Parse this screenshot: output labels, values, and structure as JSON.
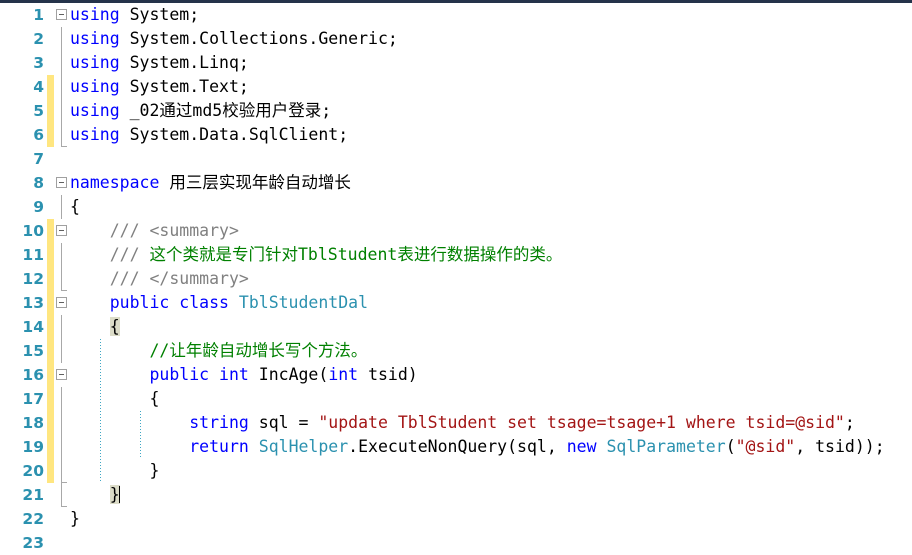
{
  "editor": {
    "language": "csharp",
    "background_color": "#ffffff",
    "top_border_color": "#25334a",
    "colors": {
      "line_number": "#2b91af",
      "keyword": "#0000ff",
      "type": "#2b91af",
      "string": "#a31515",
      "comment": "#008000",
      "doc_comment": "#808080",
      "plain_text": "#000000",
      "change_bar": "#ffe680",
      "brace_highlight": "#dcdcc8",
      "indent_guide": "#3fa7c4",
      "outline_guide": "#a8a8a8"
    },
    "lines": [
      {
        "number": "1",
        "change_bar": false,
        "fold_box": true,
        "fold_guide": "none",
        "indent_guides": [],
        "tokens": [
          {
            "text": "using ",
            "kind": "kw"
          },
          {
            "text": "System;",
            "kind": "plain"
          }
        ]
      },
      {
        "number": "2",
        "change_bar": false,
        "fold_box": false,
        "fold_guide": "full",
        "indent_guides": [],
        "tokens": [
          {
            "text": "using ",
            "kind": "kw"
          },
          {
            "text": "System.Collections.Generic;",
            "kind": "plain"
          }
        ]
      },
      {
        "number": "3",
        "change_bar": false,
        "fold_box": false,
        "fold_guide": "full",
        "indent_guides": [],
        "tokens": [
          {
            "text": "using ",
            "kind": "kw"
          },
          {
            "text": "System.Linq;",
            "kind": "plain"
          }
        ]
      },
      {
        "number": "4",
        "change_bar": true,
        "fold_box": false,
        "fold_guide": "full",
        "indent_guides": [],
        "tokens": [
          {
            "text": "using ",
            "kind": "kw"
          },
          {
            "text": "System.Text;",
            "kind": "plain"
          }
        ]
      },
      {
        "number": "5",
        "change_bar": true,
        "fold_box": false,
        "fold_guide": "full",
        "indent_guides": [],
        "tokens": [
          {
            "text": "using ",
            "kind": "kw"
          },
          {
            "text": "_02通过md5校验用户登录;",
            "kind": "plain"
          }
        ]
      },
      {
        "number": "6",
        "change_bar": true,
        "fold_box": false,
        "fold_guide": "end",
        "indent_guides": [],
        "tokens": [
          {
            "text": "using ",
            "kind": "kw"
          },
          {
            "text": "System.Data.SqlClient;",
            "kind": "plain"
          }
        ]
      },
      {
        "number": "7",
        "change_bar": false,
        "fold_box": false,
        "fold_guide": "none",
        "indent_guides": [],
        "tokens": []
      },
      {
        "number": "8",
        "change_bar": false,
        "fold_box": true,
        "fold_guide": "none",
        "indent_guides": [],
        "tokens": [
          {
            "text": "namespace ",
            "kind": "kw"
          },
          {
            "text": "用三层实现年龄自动增长",
            "kind": "plain"
          }
        ]
      },
      {
        "number": "9",
        "change_bar": false,
        "fold_box": false,
        "fold_guide": "full",
        "indent_guides": [],
        "tokens": [
          {
            "text": "{",
            "kind": "plain"
          }
        ]
      },
      {
        "number": "10",
        "change_bar": true,
        "fold_box": true,
        "fold_guide": "none",
        "indent_guides": [],
        "tokens": [
          {
            "text": "    /// ",
            "kind": "doc"
          },
          {
            "text": "<summary>",
            "kind": "doc"
          }
        ]
      },
      {
        "number": "11",
        "change_bar": true,
        "fold_box": false,
        "fold_guide": "full",
        "indent_guides": [],
        "tokens": [
          {
            "text": "    /// ",
            "kind": "doc"
          },
          {
            "text": "这个类就是专门针对TblStudent表进行数据操作的类。",
            "kind": "cmt"
          }
        ]
      },
      {
        "number": "12",
        "change_bar": true,
        "fold_box": false,
        "fold_guide": "end",
        "indent_guides": [],
        "tokens": [
          {
            "text": "    /// ",
            "kind": "doc"
          },
          {
            "text": "</summary>",
            "kind": "doc"
          }
        ]
      },
      {
        "number": "13",
        "change_bar": true,
        "fold_box": true,
        "fold_guide": "none",
        "indent_guides": [],
        "tokens": [
          {
            "text": "    ",
            "kind": "plain"
          },
          {
            "text": "public class ",
            "kind": "kw"
          },
          {
            "text": "TblStudentDal",
            "kind": "type"
          }
        ]
      },
      {
        "number": "14",
        "change_bar": true,
        "fold_box": false,
        "fold_guide": "full",
        "indent_guides": [],
        "tokens": [
          {
            "text": "    ",
            "kind": "plain"
          },
          {
            "text": "{",
            "kind": "plain",
            "highlight": true
          }
        ]
      },
      {
        "number": "15",
        "change_bar": true,
        "fold_box": false,
        "fold_guide": "full",
        "indent_guides": [
          100
        ],
        "tokens": [
          {
            "text": "        //让年龄自动增长写个方法。",
            "kind": "cmt"
          }
        ]
      },
      {
        "number": "16",
        "change_bar": true,
        "fold_box": true,
        "fold_guide": "none",
        "indent_guides": [
          100
        ],
        "tokens": [
          {
            "text": "        ",
            "kind": "plain"
          },
          {
            "text": "public int ",
            "kind": "kw"
          },
          {
            "text": "IncAge(",
            "kind": "plain"
          },
          {
            "text": "int ",
            "kind": "kw"
          },
          {
            "text": "tsid)",
            "kind": "plain"
          }
        ]
      },
      {
        "number": "17",
        "change_bar": true,
        "fold_box": false,
        "fold_guide": "full",
        "indent_guides": [
          100
        ],
        "tokens": [
          {
            "text": "        {",
            "kind": "plain"
          }
        ]
      },
      {
        "number": "18",
        "change_bar": true,
        "fold_box": false,
        "fold_guide": "full",
        "indent_guides": [
          100,
          140
        ],
        "tokens": [
          {
            "text": "            ",
            "kind": "plain"
          },
          {
            "text": "string ",
            "kind": "kw"
          },
          {
            "text": "sql = ",
            "kind": "plain"
          },
          {
            "text": "\"update TblStudent set tsage=tsage+1 where tsid=@sid\"",
            "kind": "str"
          },
          {
            "text": ";",
            "kind": "plain"
          }
        ]
      },
      {
        "number": "19",
        "change_bar": true,
        "fold_box": false,
        "fold_guide": "full",
        "indent_guides": [
          100,
          140
        ],
        "tokens": [
          {
            "text": "            ",
            "kind": "plain"
          },
          {
            "text": "return ",
            "kind": "kw"
          },
          {
            "text": "SqlHelper",
            "kind": "type"
          },
          {
            "text": ".ExecuteNonQuery(sql, ",
            "kind": "plain"
          },
          {
            "text": "new ",
            "kind": "kw"
          },
          {
            "text": "SqlParameter",
            "kind": "type"
          },
          {
            "text": "(",
            "kind": "plain"
          },
          {
            "text": "\"@sid\"",
            "kind": "str"
          },
          {
            "text": ", tsid));",
            "kind": "plain"
          }
        ]
      },
      {
        "number": "20",
        "change_bar": true,
        "fold_box": false,
        "fold_guide": "end",
        "indent_guides": [
          100
        ],
        "tokens": [
          {
            "text": "        }",
            "kind": "plain"
          }
        ]
      },
      {
        "number": "21",
        "change_bar": false,
        "fold_box": false,
        "fold_guide": "end",
        "indent_guides": [],
        "tokens": [
          {
            "text": "    ",
            "kind": "plain"
          },
          {
            "text": "}",
            "kind": "plain",
            "highlight": true,
            "caret_after": true
          }
        ]
      },
      {
        "number": "22",
        "change_bar": false,
        "fold_box": false,
        "fold_guide": "none",
        "indent_guides": [],
        "tokens": [
          {
            "text": "}",
            "kind": "plain"
          }
        ]
      },
      {
        "number": "23",
        "change_bar": false,
        "fold_box": false,
        "fold_guide": "none",
        "indent_guides": [],
        "tokens": []
      }
    ]
  }
}
